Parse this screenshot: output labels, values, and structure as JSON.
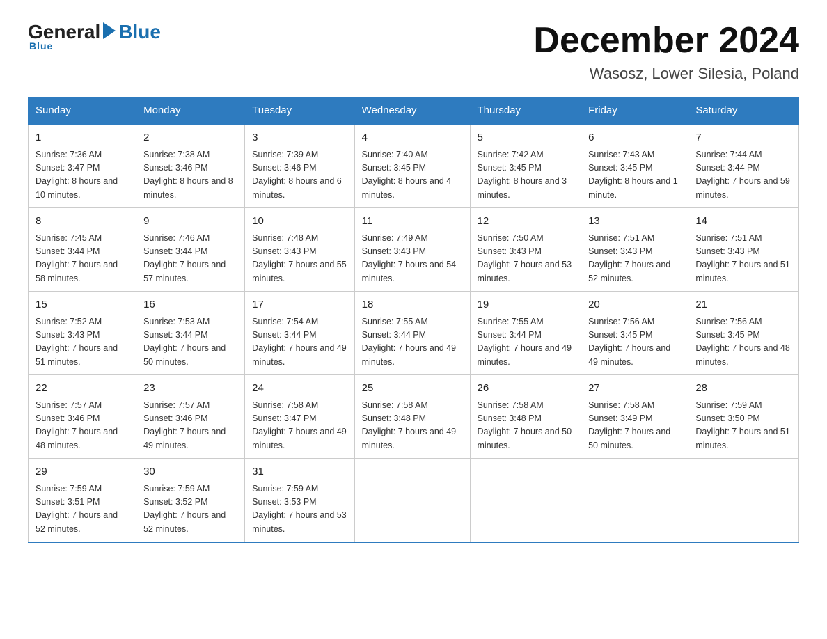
{
  "header": {
    "logo_general": "General",
    "logo_blue": "Blue",
    "month_title": "December 2024",
    "location": "Wasosz, Lower Silesia, Poland"
  },
  "days_of_week": [
    "Sunday",
    "Monday",
    "Tuesday",
    "Wednesday",
    "Thursday",
    "Friday",
    "Saturday"
  ],
  "weeks": [
    [
      {
        "day": "1",
        "sunrise": "7:36 AM",
        "sunset": "3:47 PM",
        "daylight": "8 hours and 10 minutes."
      },
      {
        "day": "2",
        "sunrise": "7:38 AM",
        "sunset": "3:46 PM",
        "daylight": "8 hours and 8 minutes."
      },
      {
        "day": "3",
        "sunrise": "7:39 AM",
        "sunset": "3:46 PM",
        "daylight": "8 hours and 6 minutes."
      },
      {
        "day": "4",
        "sunrise": "7:40 AM",
        "sunset": "3:45 PM",
        "daylight": "8 hours and 4 minutes."
      },
      {
        "day": "5",
        "sunrise": "7:42 AM",
        "sunset": "3:45 PM",
        "daylight": "8 hours and 3 minutes."
      },
      {
        "day": "6",
        "sunrise": "7:43 AM",
        "sunset": "3:45 PM",
        "daylight": "8 hours and 1 minute."
      },
      {
        "day": "7",
        "sunrise": "7:44 AM",
        "sunset": "3:44 PM",
        "daylight": "7 hours and 59 minutes."
      }
    ],
    [
      {
        "day": "8",
        "sunrise": "7:45 AM",
        "sunset": "3:44 PM",
        "daylight": "7 hours and 58 minutes."
      },
      {
        "day": "9",
        "sunrise": "7:46 AM",
        "sunset": "3:44 PM",
        "daylight": "7 hours and 57 minutes."
      },
      {
        "day": "10",
        "sunrise": "7:48 AM",
        "sunset": "3:43 PM",
        "daylight": "7 hours and 55 minutes."
      },
      {
        "day": "11",
        "sunrise": "7:49 AM",
        "sunset": "3:43 PM",
        "daylight": "7 hours and 54 minutes."
      },
      {
        "day": "12",
        "sunrise": "7:50 AM",
        "sunset": "3:43 PM",
        "daylight": "7 hours and 53 minutes."
      },
      {
        "day": "13",
        "sunrise": "7:51 AM",
        "sunset": "3:43 PM",
        "daylight": "7 hours and 52 minutes."
      },
      {
        "day": "14",
        "sunrise": "7:51 AM",
        "sunset": "3:43 PM",
        "daylight": "7 hours and 51 minutes."
      }
    ],
    [
      {
        "day": "15",
        "sunrise": "7:52 AM",
        "sunset": "3:43 PM",
        "daylight": "7 hours and 51 minutes."
      },
      {
        "day": "16",
        "sunrise": "7:53 AM",
        "sunset": "3:44 PM",
        "daylight": "7 hours and 50 minutes."
      },
      {
        "day": "17",
        "sunrise": "7:54 AM",
        "sunset": "3:44 PM",
        "daylight": "7 hours and 49 minutes."
      },
      {
        "day": "18",
        "sunrise": "7:55 AM",
        "sunset": "3:44 PM",
        "daylight": "7 hours and 49 minutes."
      },
      {
        "day": "19",
        "sunrise": "7:55 AM",
        "sunset": "3:44 PM",
        "daylight": "7 hours and 49 minutes."
      },
      {
        "day": "20",
        "sunrise": "7:56 AM",
        "sunset": "3:45 PM",
        "daylight": "7 hours and 49 minutes."
      },
      {
        "day": "21",
        "sunrise": "7:56 AM",
        "sunset": "3:45 PM",
        "daylight": "7 hours and 48 minutes."
      }
    ],
    [
      {
        "day": "22",
        "sunrise": "7:57 AM",
        "sunset": "3:46 PM",
        "daylight": "7 hours and 48 minutes."
      },
      {
        "day": "23",
        "sunrise": "7:57 AM",
        "sunset": "3:46 PM",
        "daylight": "7 hours and 49 minutes."
      },
      {
        "day": "24",
        "sunrise": "7:58 AM",
        "sunset": "3:47 PM",
        "daylight": "7 hours and 49 minutes."
      },
      {
        "day": "25",
        "sunrise": "7:58 AM",
        "sunset": "3:48 PM",
        "daylight": "7 hours and 49 minutes."
      },
      {
        "day": "26",
        "sunrise": "7:58 AM",
        "sunset": "3:48 PM",
        "daylight": "7 hours and 50 minutes."
      },
      {
        "day": "27",
        "sunrise": "7:58 AM",
        "sunset": "3:49 PM",
        "daylight": "7 hours and 50 minutes."
      },
      {
        "day": "28",
        "sunrise": "7:59 AM",
        "sunset": "3:50 PM",
        "daylight": "7 hours and 51 minutes."
      }
    ],
    [
      {
        "day": "29",
        "sunrise": "7:59 AM",
        "sunset": "3:51 PM",
        "daylight": "7 hours and 52 minutes."
      },
      {
        "day": "30",
        "sunrise": "7:59 AM",
        "sunset": "3:52 PM",
        "daylight": "7 hours and 52 minutes."
      },
      {
        "day": "31",
        "sunrise": "7:59 AM",
        "sunset": "3:53 PM",
        "daylight": "7 hours and 53 minutes."
      },
      null,
      null,
      null,
      null
    ]
  ]
}
